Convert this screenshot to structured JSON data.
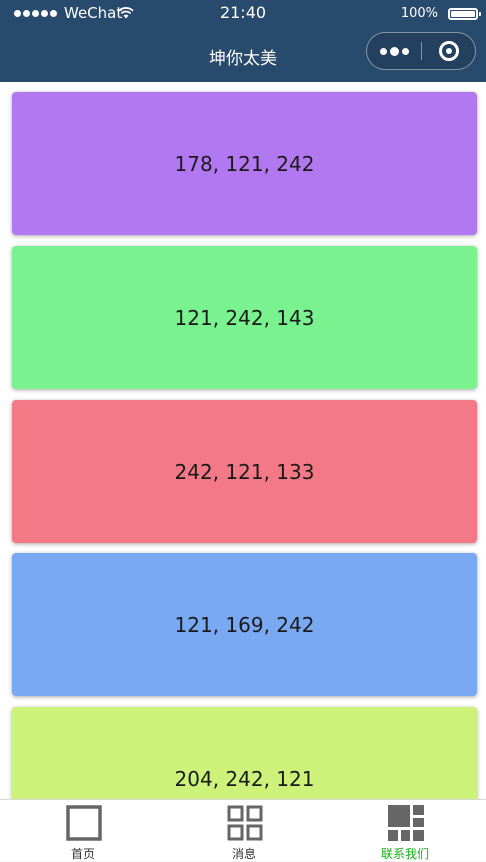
{
  "status_bar": {
    "carrier": "WeChat",
    "time": "21:40",
    "battery": "100%"
  },
  "nav_bar": {
    "title": "坤你太美"
  },
  "cards": [
    {
      "label": "178, 121, 242",
      "color": "#b278f2"
    },
    {
      "label": "121, 242, 143",
      "color": "#79f28f"
    },
    {
      "label": "242, 121, 133",
      "color": "#f27985"
    },
    {
      "label": "121, 169, 242",
      "color": "#79a9f2"
    },
    {
      "label": "204, 242, 121",
      "color": "#ccf279"
    }
  ],
  "tab_bar": {
    "tabs": [
      {
        "label": "首页",
        "icon": "square-outline-icon"
      },
      {
        "label": "消息",
        "icon": "grid-four-icon"
      },
      {
        "label": "联系我们",
        "icon": "grid-blocks-icon"
      }
    ],
    "active_color": "#1aad19"
  },
  "colors": {
    "header": "#284a6c"
  }
}
